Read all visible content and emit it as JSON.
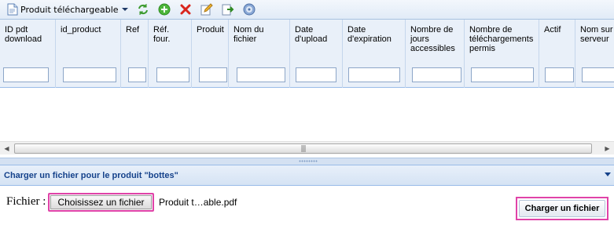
{
  "toolbar": {
    "menu_label": "Produit téléchargeable",
    "buttons": [
      {
        "name": "refresh-icon",
        "title": "refresh"
      },
      {
        "name": "add-icon",
        "title": "add"
      },
      {
        "name": "delete-icon",
        "title": "delete"
      },
      {
        "name": "edit-icon",
        "title": "edit"
      },
      {
        "name": "export-icon",
        "title": "export"
      },
      {
        "name": "help-icon",
        "title": "help"
      }
    ]
  },
  "grid": {
    "columns": [
      {
        "label": "ID pdt\ndownload"
      },
      {
        "label": "id_product"
      },
      {
        "label": "Ref"
      },
      {
        "label": "Réf.\nfour."
      },
      {
        "label": "Produit"
      },
      {
        "label": "Nom du\nfichier"
      },
      {
        "label": "Date\nd'upload"
      },
      {
        "label": "Date\nd'expiration"
      },
      {
        "label": "Nombre de\njours\naccessibles"
      },
      {
        "label": "Nombre de\ntéléchargements\npermis"
      },
      {
        "label": "Actif"
      },
      {
        "label": "Nom sur\nserveur"
      }
    ]
  },
  "panel": {
    "title": "Charger un fichier pour le produit \"bottes\"",
    "file_label": "Fichier :",
    "choose_button": "Choisissez un fichier",
    "file_name": "Produit t…able.pdf",
    "upload_button": "Charger un fichier"
  },
  "colors": {
    "accent": "#15428b",
    "highlight": "#e043a8"
  }
}
